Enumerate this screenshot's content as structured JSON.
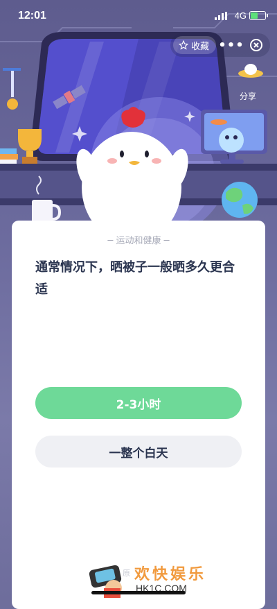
{
  "status_bar": {
    "time": "12:01",
    "network": "4G"
  },
  "top_actions": {
    "favorite_label": "收藏",
    "more_label": "•••",
    "share_label": "分享"
  },
  "card": {
    "category": "运动和健康",
    "question": "通常情况下，晒被子一般晒多久更合适",
    "options": [
      {
        "label": "2-3小时",
        "highlighted": true
      },
      {
        "label": "一整个白天",
        "highlighted": false
      }
    ],
    "footer_note": "原"
  },
  "watermark": {
    "title": "欢快娱乐",
    "site": "HK1C.COM"
  },
  "colors": {
    "accent_green": "#6ed998",
    "option_grey": "#eff0f4",
    "question_text": "#2b3550",
    "card_bg": "#ffffff"
  }
}
